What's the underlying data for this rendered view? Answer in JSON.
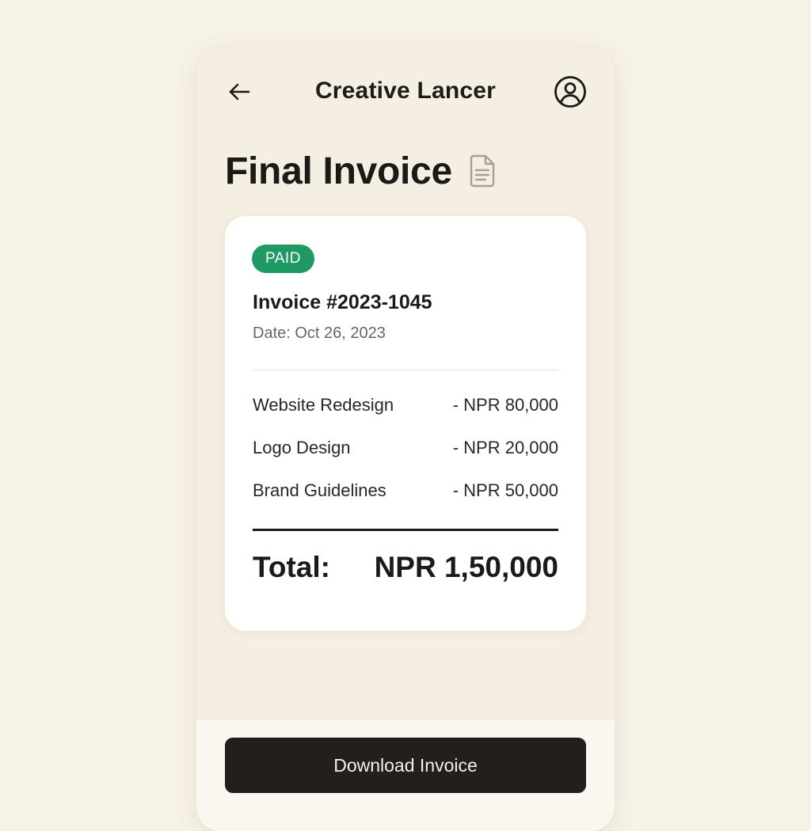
{
  "header": {
    "app_title": "Creative Lancer",
    "back_icon": "arrow-left-icon",
    "profile_icon": "user-circle-icon"
  },
  "page": {
    "title": "Final Invoice",
    "title_icon": "document-icon"
  },
  "invoice": {
    "status": "PAID",
    "status_color": "#1f9a64",
    "number": "Invoice #2023-1045",
    "date": "Date: Oct 26, 2023",
    "items": [
      {
        "name": "Website Redesign",
        "amount": "- NPR 80,000"
      },
      {
        "name": "Logo Design",
        "amount": "- NPR 20,000"
      },
      {
        "name": "Brand Guidelines",
        "amount": "- NPR 50,000"
      }
    ],
    "total_label": "Total:",
    "total_value": "NPR 1,50,000"
  },
  "footer": {
    "download_label": "Download Invoice"
  }
}
